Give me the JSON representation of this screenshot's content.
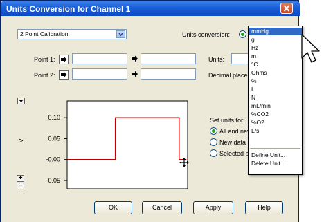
{
  "window": {
    "title": "Units Conversion for Channel 1"
  },
  "calibration": {
    "selected": "2 Point Calibration"
  },
  "units_conversion": {
    "label": "Units conversion:"
  },
  "points": {
    "point1_label": "Point 1:",
    "point2_label": "Point 2:"
  },
  "units": {
    "label": "Units:"
  },
  "decimal": {
    "label": "Decimal places"
  },
  "set_units": {
    "label": "Set units for:",
    "options": [
      "All and nev",
      "New data",
      "Selected b"
    ],
    "selected_index": 0
  },
  "graph": {
    "expand_label": ">",
    "plus_label": "+",
    "minus_label": "−"
  },
  "chart_data": {
    "type": "line",
    "yticks": [
      0.1,
      0.05,
      -0.0,
      -0.05
    ],
    "ytick_labels": [
      "0.10",
      "0.05",
      "-0.00",
      "-0.05"
    ],
    "ylim": [
      -0.07,
      0.14
    ],
    "xlim": [
      0,
      10
    ],
    "series": [
      {
        "x": [
          0,
          4,
          4,
          9.3,
          9.3,
          9.9
        ],
        "y": [
          0,
          0,
          0.1,
          0.1,
          0,
          0
        ]
      }
    ],
    "colors": [
      "#c00000"
    ]
  },
  "buttons": {
    "ok": "OK",
    "cancel": "Cancel",
    "apply": "Apply",
    "help": "Help"
  },
  "units_dropdown": {
    "items": [
      "mmHg",
      "g",
      "Hz",
      "m",
      "°C",
      "Ohms",
      "%",
      "L",
      "N",
      "mL/min",
      "%CO2",
      "%O2",
      "L/s"
    ],
    "selected_index": 0,
    "actions": [
      "Define Unit...",
      "Delete Unit..."
    ]
  }
}
